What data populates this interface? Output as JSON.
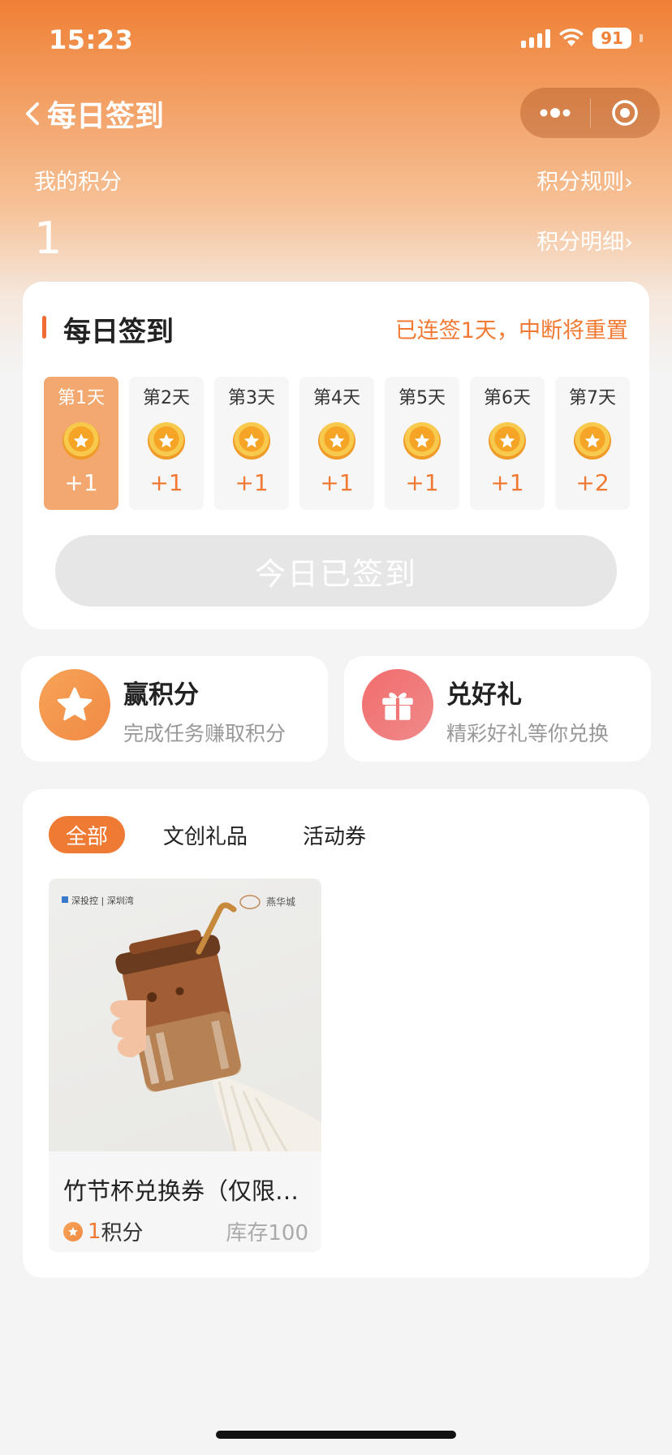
{
  "status_bar": {
    "time": "15:23",
    "battery": "91"
  },
  "nav": {
    "title": "每日签到"
  },
  "points": {
    "label": "我的积分",
    "value": "1",
    "rules_link": "积分规则›",
    "detail_link": "积分明细›"
  },
  "signin": {
    "title": "每日签到",
    "streak_text": "已连签1天，中断将重置",
    "days": [
      {
        "label": "第1天",
        "bonus": "+1",
        "active": true
      },
      {
        "label": "第2天",
        "bonus": "+1",
        "active": false
      },
      {
        "label": "第3天",
        "bonus": "+1",
        "active": false
      },
      {
        "label": "第4天",
        "bonus": "+1",
        "active": false
      },
      {
        "label": "第5天",
        "bonus": "+1",
        "active": false
      },
      {
        "label": "第6天",
        "bonus": "+1",
        "active": false
      },
      {
        "label": "第7天",
        "bonus": "+2",
        "active": false
      }
    ],
    "button_label": "今日已签到"
  },
  "features": {
    "earn": {
      "title": "赢积分",
      "subtitle": "完成任务赚取积分",
      "icon": "star-icon"
    },
    "redeem": {
      "title": "兑好礼",
      "subtitle": "精彩好礼等你兑换",
      "icon": "gift-icon"
    }
  },
  "shop": {
    "tabs": [
      "全部",
      "文创礼品",
      "活动券"
    ],
    "active_tab": 0,
    "products": [
      {
        "name": "竹节杯兑换券（仅限…",
        "price_value": "1",
        "price_unit": "积分",
        "stock": "库存100",
        "image_logo_left": "深投控 | 深圳湾",
        "image_logo_right": "燕华城"
      }
    ]
  },
  "colors": {
    "accent": "#ef7a33",
    "disabled": "#e6e6e6"
  }
}
